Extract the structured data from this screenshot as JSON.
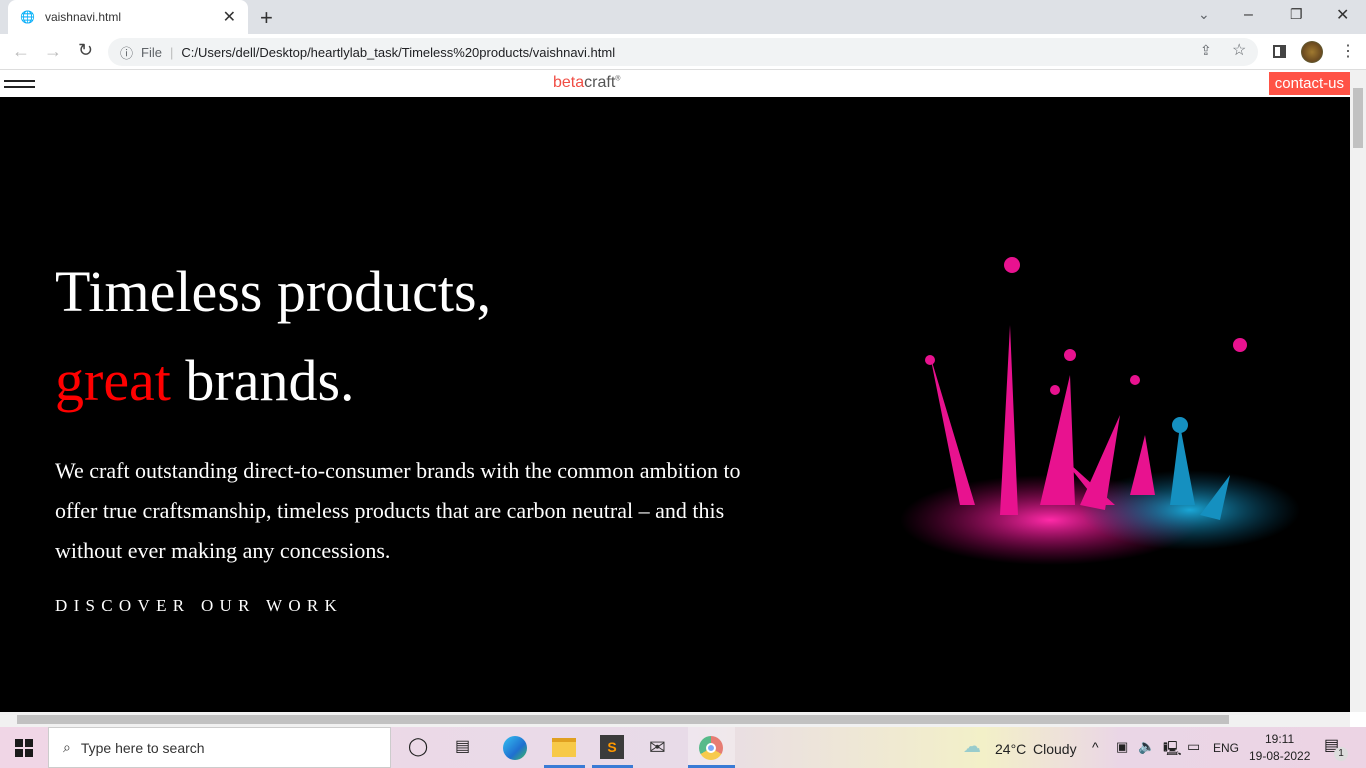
{
  "browser": {
    "tab_title": "vaishnavi.html",
    "url_scheme_label": "File",
    "url": "C:/Users/dell/Desktop/heartlylab_task/Timeless%20products/vaishnavi.html"
  },
  "site": {
    "logo_part1": "beta",
    "logo_part2": "craft",
    "logo_mark": "®",
    "contact_label": "contact-us",
    "headline_line1": "Timeless products,",
    "headline_accent": "great",
    "headline_rest": " brands.",
    "paragraph": "We craft outstanding direct-to-consumer brands with the common ambition to offer true craftsmanship, timeless products that are carbon neutral – and this without ever making any concessions.",
    "cta": "DISCOVER OUR WORK",
    "accent_color": "#ff0000",
    "contact_color": "#ff5346"
  },
  "taskbar": {
    "search_placeholder": "Type here to search",
    "weather_temp": "24°C",
    "weather_text": "Cloudy",
    "lang": "ENG",
    "time": "19:11",
    "date": "19-08-2022",
    "notif_count": "1"
  }
}
